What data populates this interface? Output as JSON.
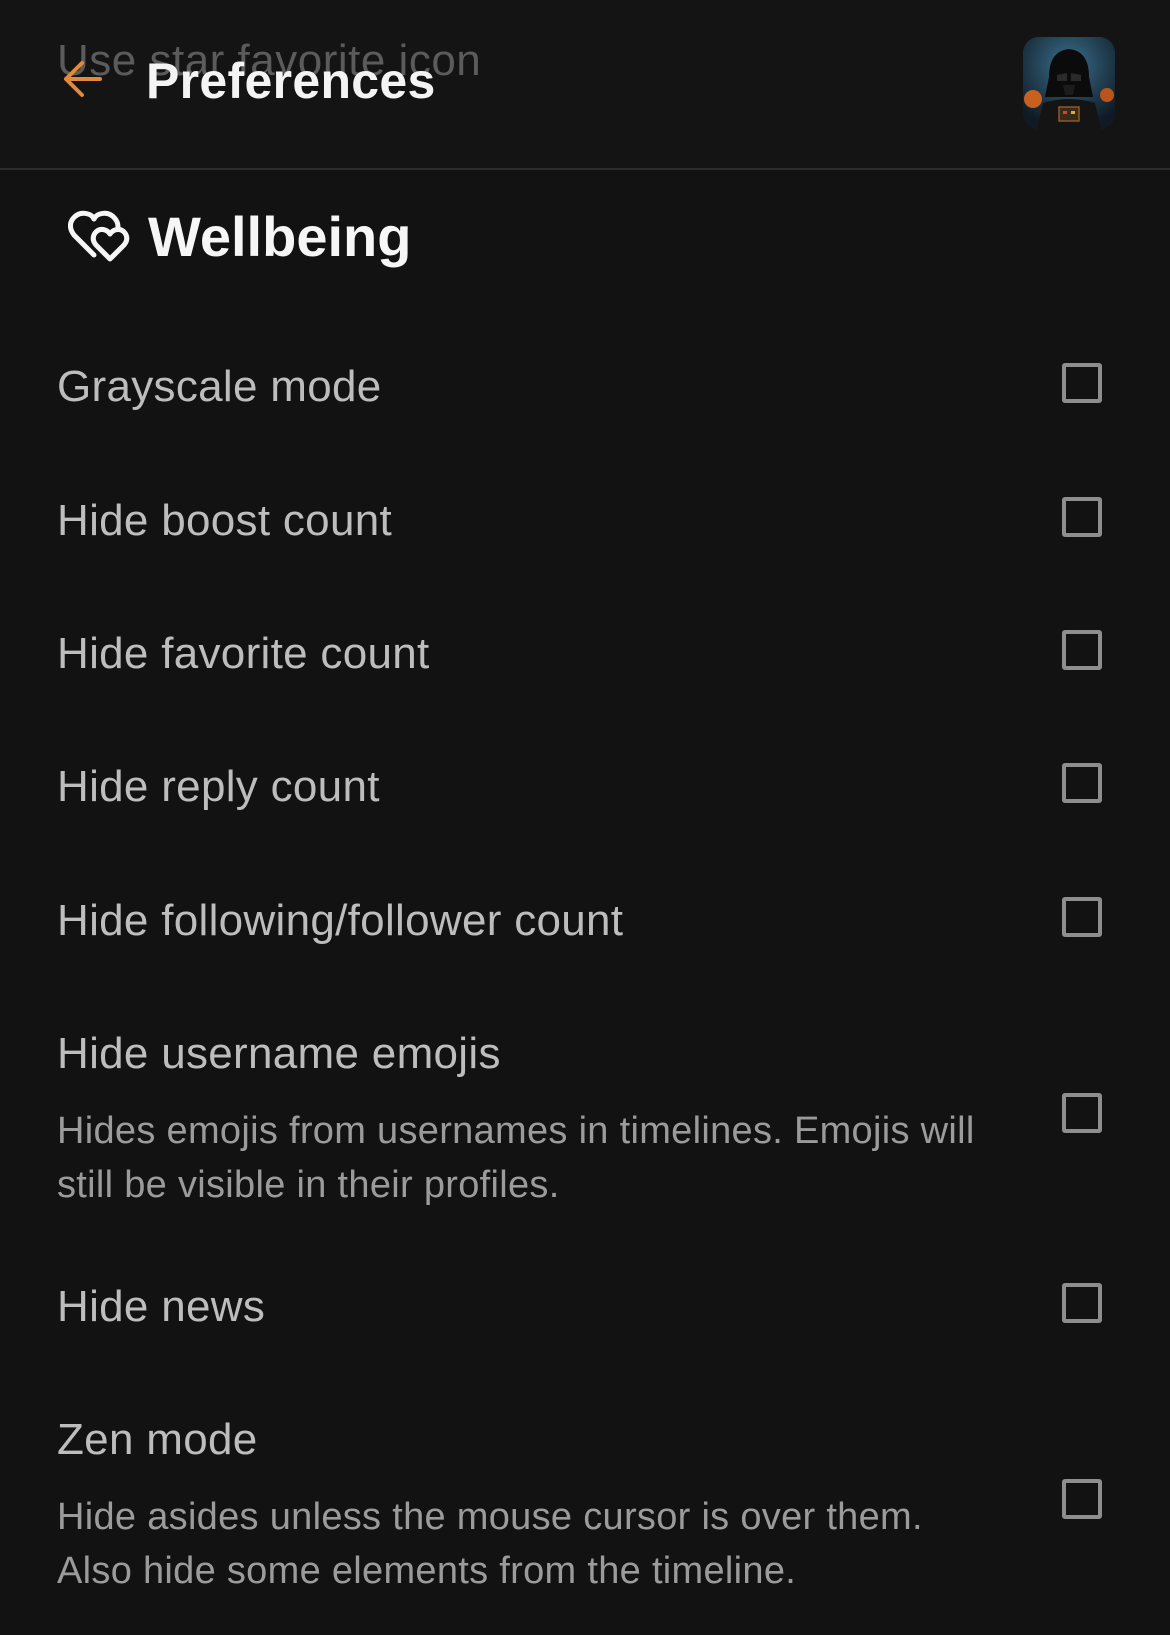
{
  "header": {
    "ghost_text": "Use star favorite icon",
    "title": "Preferences",
    "back_icon": "arrow-left-icon",
    "accent_color": "#e08a3c",
    "avatar_icon": "user-avatar"
  },
  "section": {
    "icon": "hearts-icon",
    "title": "Wellbeing"
  },
  "settings": [
    {
      "label": "Grayscale mode",
      "checked": false
    },
    {
      "label": "Hide boost count",
      "checked": false
    },
    {
      "label": "Hide favorite count",
      "checked": false
    },
    {
      "label": "Hide reply count",
      "checked": false
    },
    {
      "label": "Hide following/follower count",
      "checked": false
    },
    {
      "label": "Hide username emojis",
      "description": "Hides emojis from usernames in timelines. Emojis will still be visible in their profiles.",
      "checked": false
    },
    {
      "label": "Hide news",
      "checked": false
    },
    {
      "label": "Zen mode",
      "description": "Hide asides unless the mouse cursor is over them. Also hide some elements from the timeline.",
      "checked": false
    }
  ]
}
